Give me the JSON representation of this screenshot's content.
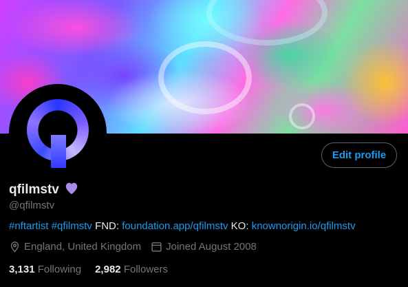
{
  "profile": {
    "display_name": "qfilmstv",
    "handle": "@qfilmstv",
    "edit_button_label": "Edit profile",
    "bio": {
      "hashtag1": "#nftartist",
      "hashtag2": "#qfilmstv",
      "fnd_label": "FND:",
      "fnd_link": "foundation.app/qfilmstv",
      "ko_label": "KO:",
      "ko_link": "knownorigin.io/qfilmstv"
    },
    "location": "England, United Kingdom",
    "joined": "Joined August 2008",
    "following_count": "3,131",
    "following_label": "Following",
    "followers_count": "2,982",
    "followers_label": "Followers"
  },
  "colors": {
    "accent": "#1d9bf0",
    "heart": "#a98be8",
    "muted": "#71767b"
  }
}
